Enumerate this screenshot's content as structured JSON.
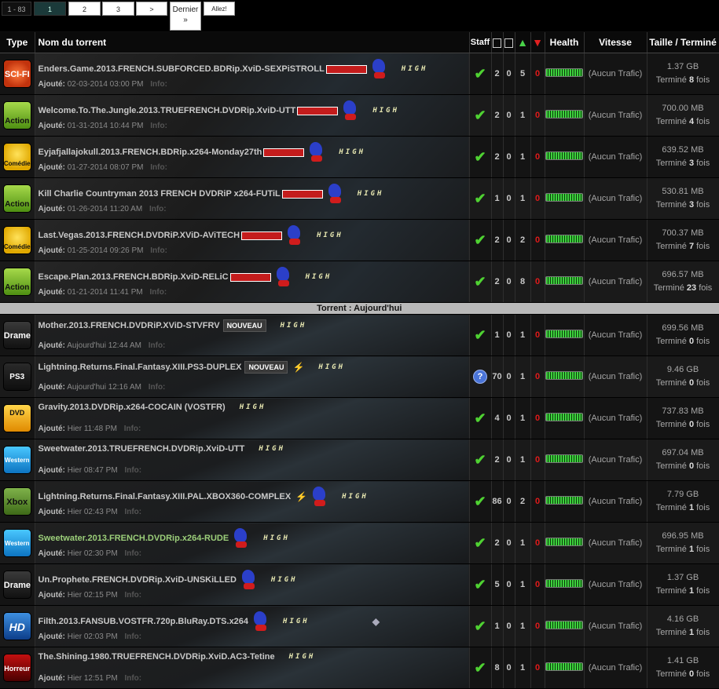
{
  "pagination": {
    "range": "1 - 83",
    "current": "1",
    "pages": [
      "2",
      "3"
    ],
    "next": ">",
    "last_line1": "Dernier",
    "last_line2": "»",
    "go": "Allez!"
  },
  "headers": {
    "type": "Type",
    "name": "Nom du torrent",
    "staff": "Staff",
    "health": "Health",
    "speed": "Vitesse",
    "size": "Taille / Terminé"
  },
  "labels": {
    "added": "Ajouté:",
    "info": "Info:",
    "finished_prefix": "Terminé",
    "finished_suffix": "fois",
    "badge_new": "NOUVEAU",
    "high": "HIGH"
  },
  "section_today": "Torrent : Aujourd'hui",
  "torrents_top": [
    {
      "cat": "SCI-FI",
      "cat_class": "scifi",
      "name": "Enders.Game.2013.FRENCH.SUBFORCED.BDRip.XviD-SEXPiSTROLL",
      "date": "02-03-2014 03:00 PM",
      "staff": "check",
      "a": "2",
      "b": "0",
      "seed": "5",
      "leech": "0",
      "speed": "(Aucun Trafic)",
      "size": "1.37 GB",
      "done": "8"
    },
    {
      "cat": "Action",
      "cat_class": "action",
      "name": "Welcome.To.The.Jungle.2013.TRUEFRENCH.DVDRip.XviD-UTT",
      "date": "01-31-2014 10:44 PM",
      "staff": "check",
      "a": "2",
      "b": "0",
      "seed": "1",
      "leech": "0",
      "speed": "(Aucun Trafic)",
      "size": "700.00 MB",
      "done": "4"
    },
    {
      "cat": "Comédie",
      "cat_class": "comedie",
      "name": "Eyjafjallajokull.2013.FRENCH.BDRip.x264-Monday27th",
      "date": "01-27-2014 08:07 PM",
      "staff": "check",
      "a": "2",
      "b": "0",
      "seed": "1",
      "leech": "0",
      "speed": "(Aucun Trafic)",
      "size": "639.52 MB",
      "done": "3"
    },
    {
      "cat": "Action",
      "cat_class": "action",
      "name": "Kill Charlie Countryman 2013 FRENCH DVDRiP x264-FUTiL",
      "date": "01-26-2014 11:20 AM",
      "staff": "check",
      "a": "1",
      "b": "0",
      "seed": "1",
      "leech": "0",
      "speed": "(Aucun Trafic)",
      "size": "530.81 MB",
      "done": "3"
    },
    {
      "cat": "Comédie",
      "cat_class": "comedie",
      "name": "Last.Vegas.2013.FRENCH.DVDRiP.XViD-AViTECH",
      "date": "01-25-2014 09:26 PM",
      "staff": "check",
      "a": "2",
      "b": "0",
      "seed": "2",
      "leech": "0",
      "speed": "(Aucun Trafic)",
      "size": "700.37 MB",
      "done": "7"
    },
    {
      "cat": "Action",
      "cat_class": "action",
      "name": "Escape.Plan.2013.FRENCH.BDRip.XviD-RELiC",
      "date": "01-21-2014 11:41 PM",
      "staff": "check",
      "a": "2",
      "b": "0",
      "seed": "8",
      "leech": "0",
      "speed": "(Aucun Trafic)",
      "size": "696.57 MB",
      "done": "23"
    }
  ],
  "torrents_today": [
    {
      "cat": "Drame",
      "cat_class": "drame",
      "name": "Mother.2013.FRENCH.DVDRiP.XViD-STVFRV",
      "date": "Aujourd'hui 12:44 AM",
      "staff": "check",
      "a": "1",
      "b": "0",
      "seed": "1",
      "leech": "0",
      "speed": "(Aucun Trafic)",
      "size": "699.56 MB",
      "done": "0"
    },
    {
      "cat": "PS3",
      "cat_class": "jeux",
      "name": "Lightning.Returns.Final.Fantasy.XIII.PS3-DUPLEX",
      "date": "Aujourd'hui 12:16 AM",
      "staff": "unknown",
      "a": "70",
      "b": "0",
      "seed": "1",
      "leech": "0",
      "speed": "(Aucun Trafic)",
      "size": "9.46 GB",
      "done": "0"
    },
    {
      "cat": "DVD",
      "cat_class": "dvd",
      "name": "Gravity.2013.DVDRip.x264-COCAIN (VOSTFR)",
      "date": "Hier 11:48 PM",
      "staff": "check",
      "a": "4",
      "b": "0",
      "seed": "1",
      "leech": "0",
      "speed": "(Aucun Trafic)",
      "size": "737.83 MB",
      "done": "0"
    },
    {
      "cat": "Western",
      "cat_class": "western",
      "name": "Sweetwater.2013.TRUEFRENCH.DVDRip.XviD-UTT",
      "date": "Hier 08:47 PM",
      "staff": "check",
      "a": "2",
      "b": "0",
      "seed": "1",
      "leech": "0",
      "speed": "(Aucun Trafic)",
      "size": "697.04 MB",
      "done": "0"
    },
    {
      "cat": "Xbox",
      "cat_class": "xbox",
      "name": "Lightning.Returns.Final.Fantasy.XIII.PAL.XBOX360-COMPLEX",
      "date": "Hier 02:43 PM",
      "staff": "check",
      "a": "86",
      "b": "0",
      "seed": "2",
      "leech": "0",
      "speed": "(Aucun Trafic)",
      "size": "7.79 GB",
      "done": "1"
    },
    {
      "cat": "Western",
      "cat_class": "western",
      "name": "Sweetwater.2013.FRENCH.DVDRip.x264-RUDE",
      "date": "Hier 02:30 PM",
      "staff": "check",
      "a": "2",
      "b": "0",
      "seed": "1",
      "leech": "0",
      "speed": "(Aucun Trafic)",
      "size": "696.95 MB",
      "done": "1"
    },
    {
      "cat": "Drame",
      "cat_class": "drame",
      "name": "Un.Prophete.FRENCH.DVDRip.XviD-UNSKiLLED",
      "date": "Hier 02:15 PM",
      "staff": "check",
      "a": "5",
      "b": "0",
      "seed": "1",
      "leech": "0",
      "speed": "(Aucun Trafic)",
      "size": "1.37 GB",
      "done": "1"
    },
    {
      "cat": "HD",
      "cat_class": "hd",
      "name": "Filth.2013.FANSUB.VOSTFR.720p.BluRay.DTS.x264",
      "date": "Hier 02:03 PM",
      "staff": "check",
      "a": "1",
      "b": "0",
      "seed": "1",
      "leech": "0",
      "speed": "(Aucun Trafic)",
      "size": "4.16 GB",
      "done": "1"
    },
    {
      "cat": "Horreur",
      "cat_class": "horreur",
      "name": "The.Shining.1980.TRUEFRENCH.DVDRip.XviD.AC3-Tetine",
      "date": "Hier 12:51 PM",
      "staff": "check",
      "a": "8",
      "b": "0",
      "seed": "1",
      "leech": "0",
      "speed": "(Aucun Trafic)",
      "size": "1.41 GB",
      "done": "0"
    }
  ],
  "colors": {
    "accent_green": "#4fd232",
    "leech_red": "#e01a1a",
    "separator": "#b9b9b9"
  }
}
